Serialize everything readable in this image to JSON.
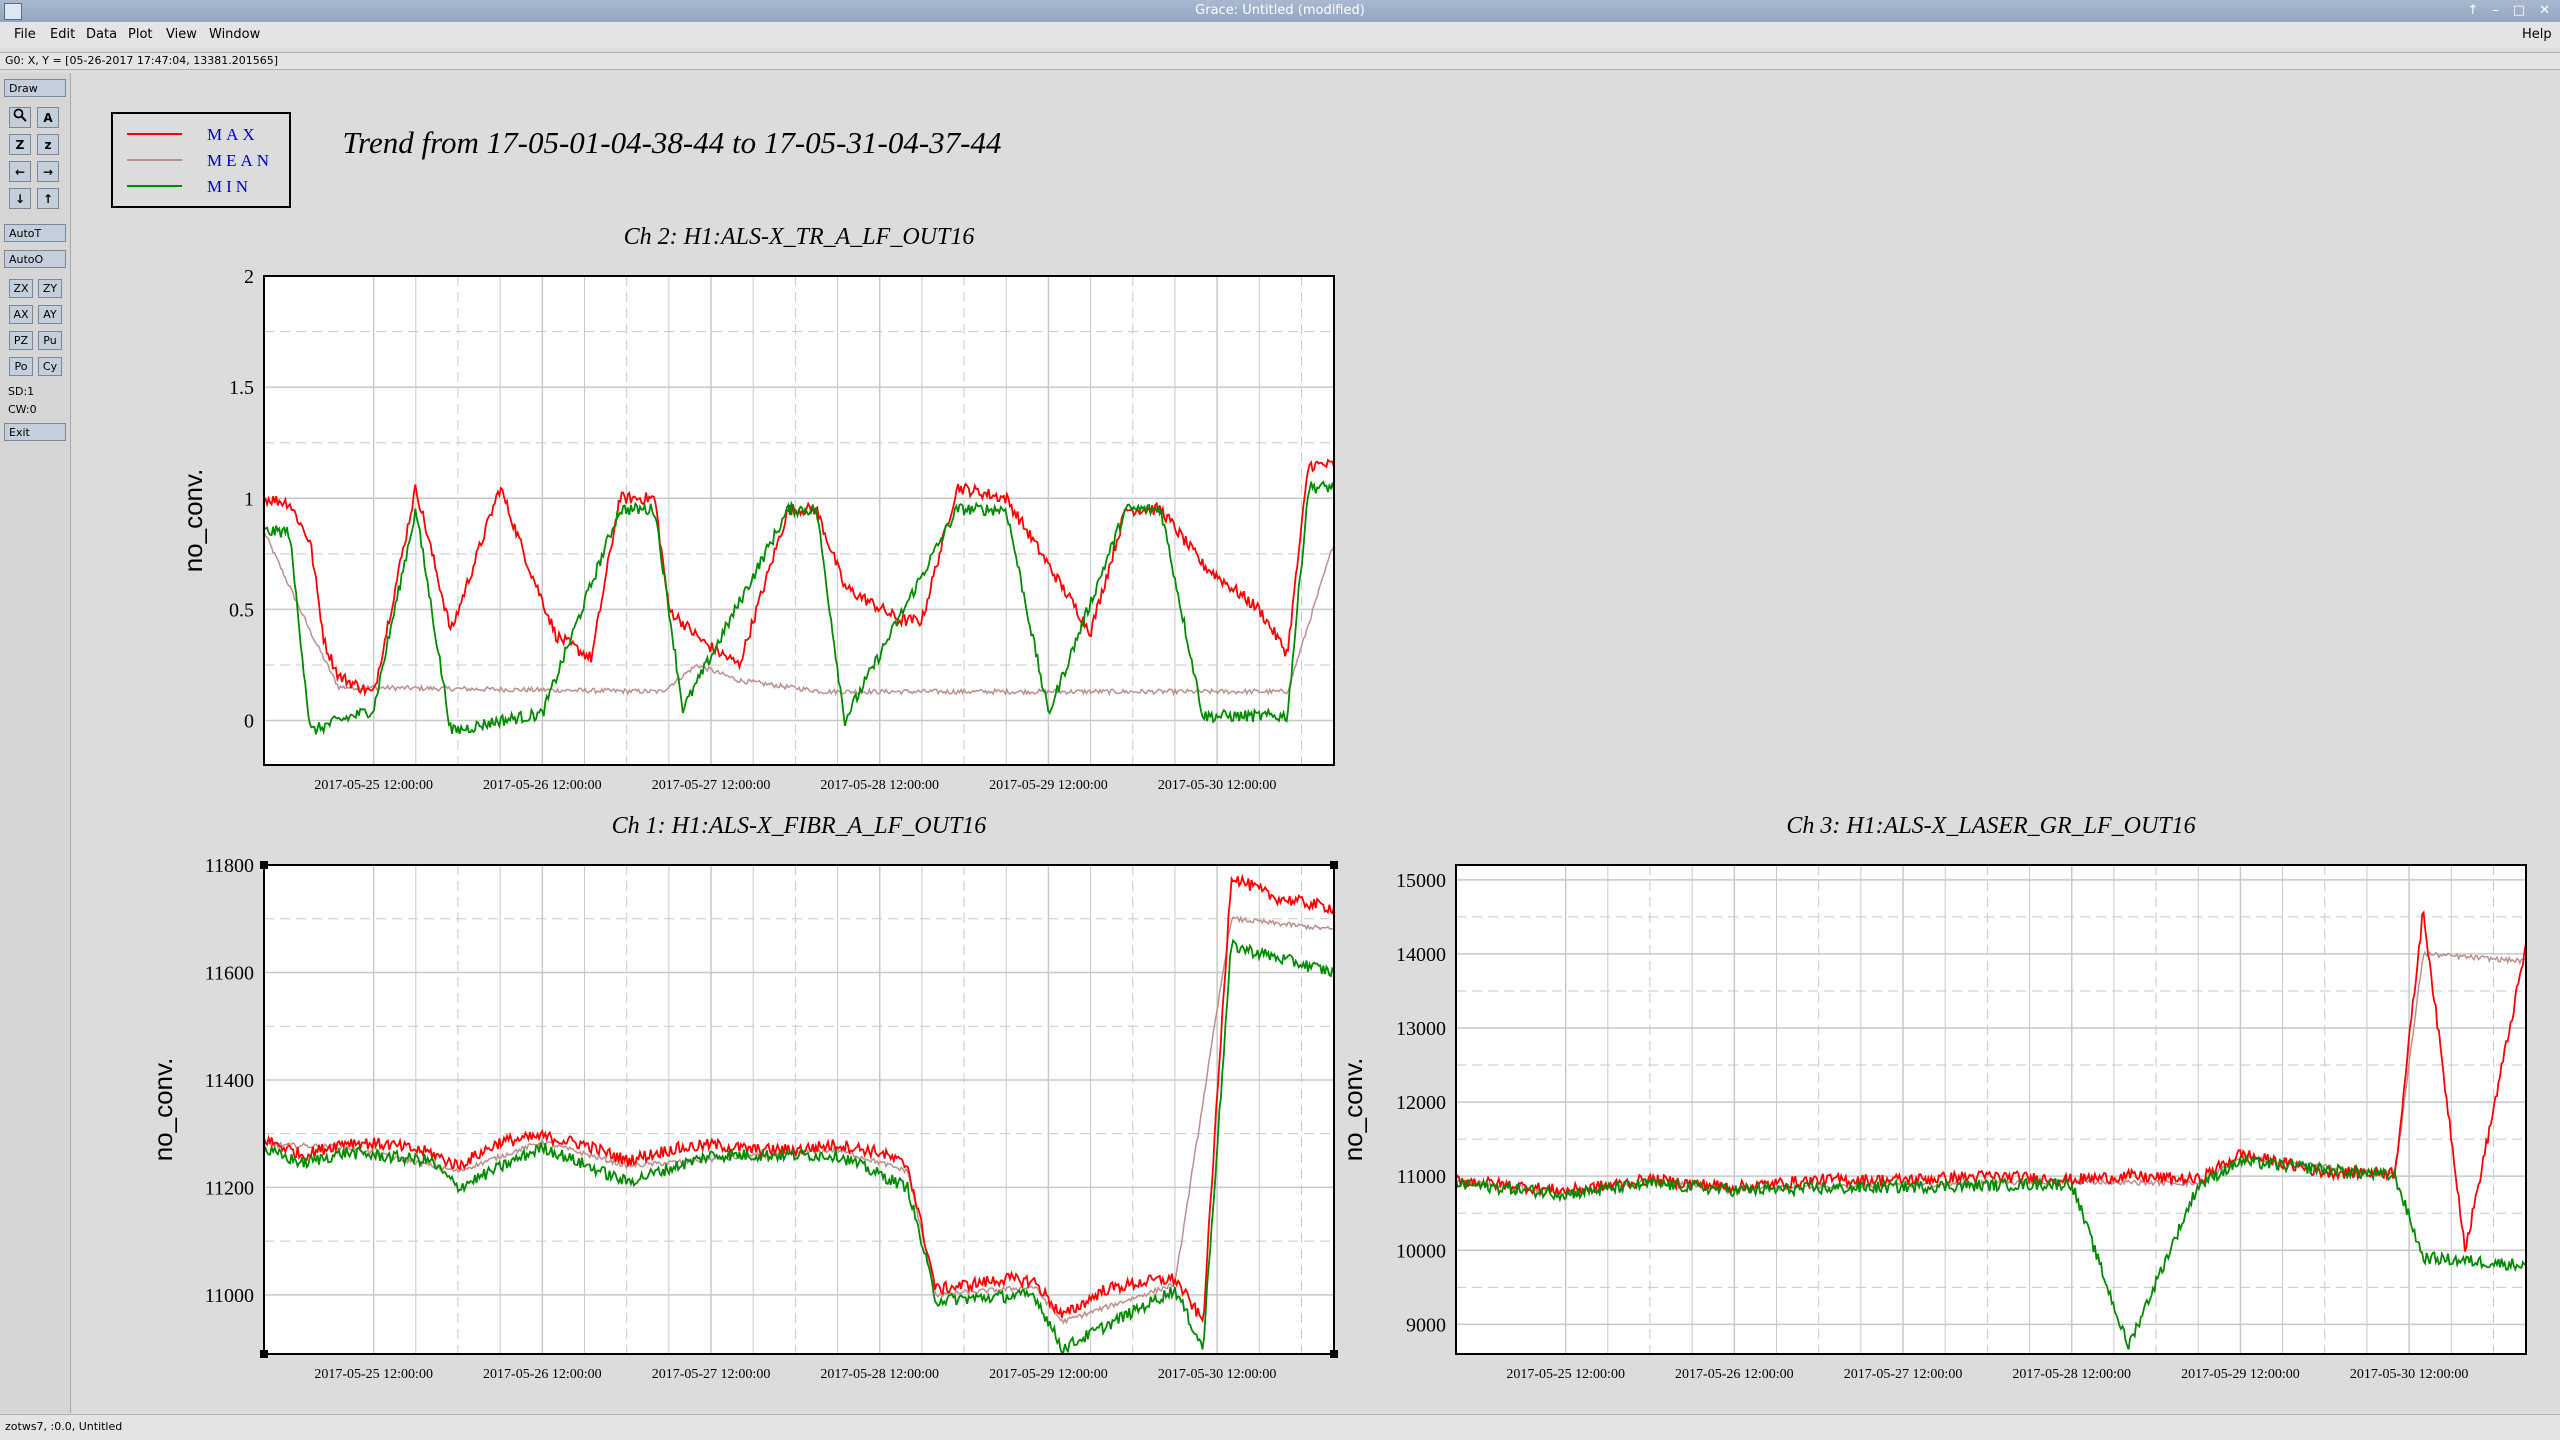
{
  "window": {
    "title": "Grace: Untitled (modified)",
    "controls": [
      "↑",
      "–",
      "□",
      "✕"
    ]
  },
  "menubar": {
    "items": [
      "File",
      "Edit",
      "Data",
      "Plot",
      "View",
      "Window"
    ],
    "help": "Help"
  },
  "locator": "G0: X, Y = [05-26-2017 17:47:04, 13381.201565]",
  "toolbar": {
    "draw": "Draw",
    "icons": [
      {
        "name": "zoom-icon",
        "glyph": "🔍"
      },
      {
        "name": "autoscale-icon",
        "glyph": "A"
      },
      {
        "name": "zoom-z-icon",
        "glyph": "Z"
      },
      {
        "name": "zoom-small-z-icon",
        "glyph": "z"
      },
      {
        "name": "scroll-left-icon",
        "glyph": "←"
      },
      {
        "name": "scroll-right-icon",
        "glyph": "→"
      },
      {
        "name": "scroll-down-icon",
        "glyph": "↓"
      },
      {
        "name": "scroll-up-icon",
        "glyph": "↑"
      }
    ],
    "autot": "AutoT",
    "autoo": "AutoO",
    "small": [
      "ZX",
      "ZY",
      "AX",
      "AY",
      "PZ",
      "Pu",
      "Po",
      "Cy"
    ],
    "sd": "SD:1",
    "cw": "CW:0",
    "exit": "Exit"
  },
  "status": "zotws7, :0.0, Untitled",
  "plot": {
    "main_title": "Trend from 17-05-01-04-38-44 to 17-05-31-04-37-44",
    "legend": [
      {
        "label": "MAX",
        "color": "#ff0000"
      },
      {
        "label": "MEAN",
        "color": "#bc8f8f"
      },
      {
        "label": "MIN",
        "color": "#008b00"
      }
    ],
    "x_ticks": [
      "2017-05-25 12:00:00",
      "2017-05-26 12:00:00",
      "2017-05-27 12:00:00",
      "2017-05-28 12:00:00",
      "2017-05-29 12:00:00",
      "2017-05-30 12:00:00"
    ]
  },
  "chart_data": [
    {
      "type": "line",
      "title": "Ch 2: H1:ALS-X_TR_A_LF_OUT16",
      "ylabel": "no_conv.",
      "xlim": [
        "2017-05-24 20:24:00",
        "2017-05-31 04:37:44"
      ],
      "ylim": [
        -0.2,
        2.0
      ],
      "y_ticks": [
        "0",
        "0.5",
        "1",
        "1.5",
        "2"
      ],
      "grid": true,
      "series": [
        {
          "name": "MAX",
          "color": "#ff0000",
          "points": [
            [
              "2017-05-24 20:24:00",
              1.0
            ],
            [
              "2017-05-25 00:00:00",
              0.98
            ],
            [
              "2017-05-25 03:00:00",
              0.8
            ],
            [
              "2017-05-25 05:00:00",
              0.35
            ],
            [
              "2017-05-25 07:00:00",
              0.2
            ],
            [
              "2017-05-25 12:00:00",
              0.12
            ],
            [
              "2017-05-25 18:00:00",
              1.05
            ],
            [
              "2017-05-25 23:00:00",
              0.4
            ],
            [
              "2017-05-26 06:00:00",
              1.05
            ],
            [
              "2017-05-26 10:00:00",
              0.7
            ],
            [
              "2017-05-26 14:00:00",
              0.38
            ],
            [
              "2017-05-26 19:00:00",
              0.28
            ],
            [
              "2017-05-26 23:00:00",
              1.0
            ],
            [
              "2017-05-27 04:00:00",
              1.0
            ],
            [
              "2017-05-27 06:00:00",
              0.5
            ],
            [
              "2017-05-27 11:00:00",
              0.35
            ],
            [
              "2017-05-27 16:00:00",
              0.25
            ],
            [
              "2017-05-27 23:00:00",
              0.95
            ],
            [
              "2017-05-28 03:00:00",
              0.95
            ],
            [
              "2017-05-28 07:00:00",
              0.6
            ],
            [
              "2017-05-28 15:00:00",
              0.45
            ],
            [
              "2017-05-28 18:00:00",
              0.45
            ],
            [
              "2017-05-28 23:00:00",
              1.05
            ],
            [
              "2017-05-29 06:00:00",
              1.0
            ],
            [
              "2017-05-29 12:00:00",
              0.7
            ],
            [
              "2017-05-29 18:00:00",
              0.4
            ],
            [
              "2017-05-29 23:00:00",
              0.95
            ],
            [
              "2017-05-30 04:00:00",
              0.95
            ],
            [
              "2017-05-30 10:00:00",
              0.7
            ],
            [
              "2017-05-30 18:00:00",
              0.5
            ],
            [
              "2017-05-30 22:00:00",
              0.3
            ],
            [
              "2017-05-31 01:00:00",
              1.15
            ],
            [
              "2017-05-31 04:37:44",
              1.15
            ]
          ]
        },
        {
          "name": "MEAN",
          "color": "#bc8f8f",
          "points": [
            [
              "2017-05-24 20:24:00",
              0.85
            ],
            [
              "2017-05-25 03:00:00",
              0.4
            ],
            [
              "2017-05-25 07:00:00",
              0.15
            ],
            [
              "2017-05-27 05:00:00",
              0.13
            ],
            [
              "2017-05-27 10:00:00",
              0.25
            ],
            [
              "2017-05-27 16:00:00",
              0.18
            ],
            [
              "2017-05-28 04:00:00",
              0.13
            ],
            [
              "2017-05-30 22:00:00",
              0.13
            ],
            [
              "2017-05-31 04:37:44",
              0.8
            ]
          ]
        },
        {
          "name": "MIN",
          "color": "#008b00",
          "points": [
            [
              "2017-05-24 20:24:00",
              0.85
            ],
            [
              "2017-05-25 00:00:00",
              0.85
            ],
            [
              "2017-05-25 03:00:00",
              -0.05
            ],
            [
              "2017-05-25 07:00:00",
              0.0
            ],
            [
              "2017-05-25 12:00:00",
              0.05
            ],
            [
              "2017-05-25 18:00:00",
              0.95
            ],
            [
              "2017-05-25 23:00:00",
              -0.05
            ],
            [
              "2017-05-26 06:00:00",
              0.0
            ],
            [
              "2017-05-26 12:00:00",
              0.03
            ],
            [
              "2017-05-26 23:00:00",
              0.95
            ],
            [
              "2017-05-27 04:00:00",
              0.95
            ],
            [
              "2017-05-27 08:00:00",
              0.05
            ],
            [
              "2017-05-27 23:00:00",
              0.95
            ],
            [
              "2017-05-28 03:00:00",
              0.95
            ],
            [
              "2017-05-28 07:00:00",
              0.0
            ],
            [
              "2017-05-28 23:00:00",
              0.95
            ],
            [
              "2017-05-29 06:00:00",
              0.95
            ],
            [
              "2017-05-29 12:00:00",
              0.03
            ],
            [
              "2017-05-29 23:00:00",
              0.95
            ],
            [
              "2017-05-30 04:00:00",
              0.95
            ],
            [
              "2017-05-30 10:00:00",
              0.02
            ],
            [
              "2017-05-30 22:00:00",
              0.02
            ],
            [
              "2017-05-31 01:00:00",
              1.05
            ],
            [
              "2017-05-31 04:37:44",
              1.05
            ]
          ]
        }
      ]
    },
    {
      "type": "line",
      "title": "Ch 1: H1:ALS-X_FIBR_A_LF_OUT16",
      "ylabel": "no_conv.",
      "xlim": [
        "2017-05-24 20:24:00",
        "2017-05-31 04:37:44"
      ],
      "ylim": [
        10890,
        11800
      ],
      "y_ticks": [
        "11000",
        "11200",
        "11400",
        "11600",
        "11800"
      ],
      "grid": true,
      "series": [
        {
          "name": "MAX",
          "color": "#ff0000",
          "points": [
            [
              "2017-05-24 20:24:00",
              11290
            ],
            [
              "2017-05-25 02:00:00",
              11260
            ],
            [
              "2017-05-25 08:00:00",
              11285
            ],
            [
              "2017-05-25 14:00:00",
              11280
            ],
            [
              "2017-05-25 20:00:00",
              11265
            ],
            [
              "2017-05-26 00:00:00",
              11240
            ],
            [
              "2017-05-26 06:00:00",
              11285
            ],
            [
              "2017-05-26 12:00:00",
              11295
            ],
            [
              "2017-05-26 18:00:00",
              11280
            ],
            [
              "2017-05-27 00:00:00",
              11250
            ],
            [
              "2017-05-27 06:00:00",
              11270
            ],
            [
              "2017-05-27 12:00:00",
              11280
            ],
            [
              "2017-05-27 18:00:00",
              11270
            ],
            [
              "2017-05-28 00:00:00",
              11270
            ],
            [
              "2017-05-28 06:00:00",
              11280
            ],
            [
              "2017-05-28 12:00:00",
              11265
            ],
            [
              "2017-05-28 16:00:00",
              11240
            ],
            [
              "2017-05-28 20:00:00",
              11010
            ],
            [
              "2017-05-29 06:00:00",
              11030
            ],
            [
              "2017-05-29 10:00:00",
              11025
            ],
            [
              "2017-05-29 14:00:00",
              10960
            ],
            [
              "2017-05-29 20:00:00",
              11010
            ],
            [
              "2017-05-30 02:00:00",
              11025
            ],
            [
              "2017-05-30 06:00:00",
              11030
            ],
            [
              "2017-05-30 10:00:00",
              10950
            ],
            [
              "2017-05-30 14:00:00",
              11780
            ],
            [
              "2017-05-30 20:00:00",
              11740
            ],
            [
              "2017-05-31 04:37:44",
              11720
            ]
          ]
        },
        {
          "name": "MEAN",
          "color": "#bc8f8f",
          "points": [
            [
              "2017-05-24 20:24:00",
              11280
            ],
            [
              "2017-05-25 08:00:00",
              11275
            ],
            [
              "2017-05-26 00:00:00",
              11230
            ],
            [
              "2017-05-26 12:00:00",
              11285
            ],
            [
              "2017-05-27 00:00:00",
              11240
            ],
            [
              "2017-05-28 06:00:00",
              11270
            ],
            [
              "2017-05-28 16:00:00",
              11230
            ],
            [
              "2017-05-28 20:00:00",
              11000
            ],
            [
              "2017-05-29 10:00:00",
              11015
            ],
            [
              "2017-05-29 14:00:00",
              10950
            ],
            [
              "2017-05-30 06:00:00",
              11020
            ],
            [
              "2017-05-30 14:00:00",
              11700
            ],
            [
              "2017-05-31 04:37:44",
              11680
            ]
          ]
        },
        {
          "name": "MIN",
          "color": "#008b00",
          "points": [
            [
              "2017-05-24 20:24:00",
              11270
            ],
            [
              "2017-05-25 02:00:00",
              11245
            ],
            [
              "2017-05-25 08:00:00",
              11265
            ],
            [
              "2017-05-25 20:00:00",
              11250
            ],
            [
              "2017-05-26 00:00:00",
              11200
            ],
            [
              "2017-05-26 12:00:00",
              11275
            ],
            [
              "2017-05-27 00:00:00",
              11210
            ],
            [
              "2017-05-27 12:00:00",
              11260
            ],
            [
              "2017-05-28 06:00:00",
              11260
            ],
            [
              "2017-05-28 16:00:00",
              11200
            ],
            [
              "2017-05-28 20:00:00",
              10990
            ],
            [
              "2017-05-29 10:00:00",
              11000
            ],
            [
              "2017-05-29 14:00:00",
              10900
            ],
            [
              "2017-05-30 06:00:00",
              11010
            ],
            [
              "2017-05-30 10:00:00",
              10900
            ],
            [
              "2017-05-30 14:00:00",
              11650
            ],
            [
              "2017-05-31 04:37:44",
              11600
            ]
          ]
        }
      ]
    },
    {
      "type": "line",
      "title": "Ch 3: H1:ALS-X_LASER_GR_LF_OUT16",
      "ylabel": "no_conv.",
      "xlim": [
        "2017-05-24 20:24:00",
        "2017-05-31 04:37:44"
      ],
      "ylim": [
        8600,
        15200
      ],
      "y_ticks": [
        "9000",
        "10000",
        "11000",
        "12000",
        "13000",
        "14000",
        "15000"
      ],
      "grid": true,
      "series": [
        {
          "name": "MAX",
          "color": "#ff0000",
          "points": [
            [
              "2017-05-24 20:24:00",
              10950
            ],
            [
              "2017-05-25 12:00:00",
              10800
            ],
            [
              "2017-05-26 00:00:00",
              10950
            ],
            [
              "2017-05-26 12:00:00",
              10850
            ],
            [
              "2017-05-27 00:00:00",
              10950
            ],
            [
              "2017-05-27 12:00:00",
              10950
            ],
            [
              "2017-05-28 00:00:00",
              11000
            ],
            [
              "2017-05-28 12:00:00",
              10950
            ],
            [
              "2017-05-28 20:00:00",
              11000
            ],
            [
              "2017-05-29 06:00:00",
              10950
            ],
            [
              "2017-05-29 12:00:00",
              11300
            ],
            [
              "2017-05-30 00:00:00",
              11050
            ],
            [
              "2017-05-30 10:00:00",
              11050
            ],
            [
              "2017-05-30 14:00:00",
              14600
            ],
            [
              "2017-05-30 20:00:00",
              10000
            ],
            [
              "2017-05-31 04:37:44",
              14100
            ]
          ]
        },
        {
          "name": "MEAN",
          "color": "#bc8f8f",
          "points": [
            [
              "2017-05-24 20:24:00",
              10930
            ],
            [
              "2017-05-25 12:00:00",
              10780
            ],
            [
              "2017-05-26 00:00:00",
              10930
            ],
            [
              "2017-05-26 12:00:00",
              10830
            ],
            [
              "2017-05-28 12:00:00",
              10930
            ],
            [
              "2017-05-29 06:00:00",
              10900
            ],
            [
              "2017-05-29 12:00:00",
              11250
            ],
            [
              "2017-05-30 10:00:00",
              11030
            ],
            [
              "2017-05-30 14:00:00",
              14000
            ],
            [
              "2017-05-31 04:37:44",
              13900
            ]
          ]
        },
        {
          "name": "MIN",
          "color": "#008b00",
          "points": [
            [
              "2017-05-24 20:24:00",
              10900
            ],
            [
              "2017-05-25 12:00:00",
              10760
            ],
            [
              "2017-05-26 00:00:00",
              10900
            ],
            [
              "2017-05-26 12:00:00",
              10810
            ],
            [
              "2017-05-28 12:00:00",
              10900
            ],
            [
              "2017-05-28 20:00:00",
              8700
            ],
            [
              "2017-05-29 06:00:00",
              10880
            ],
            [
              "2017-05-29 12:00:00",
              11200
            ],
            [
              "2017-05-30 10:00:00",
              11000
            ],
            [
              "2017-05-30 14:00:00",
              9900
            ],
            [
              "2017-05-31 04:37:44",
              9800
            ]
          ]
        }
      ]
    }
  ]
}
